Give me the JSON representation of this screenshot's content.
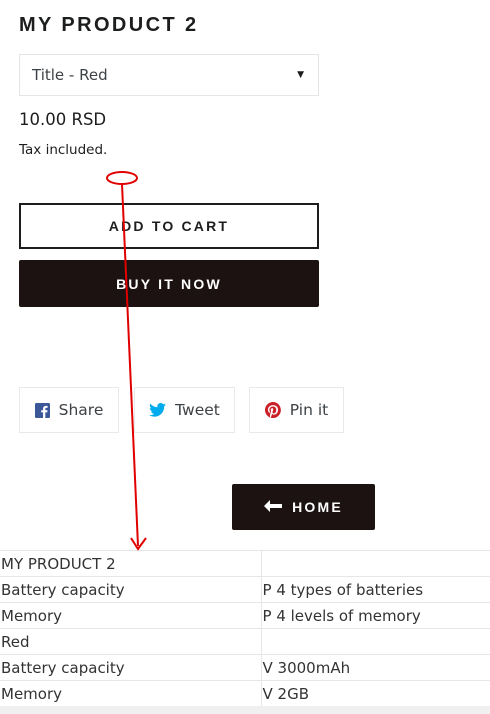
{
  "product": {
    "title": "MY PRODUCT 2",
    "variant_select": {
      "value": "Title  -  Red"
    },
    "price": "10.00 RSD",
    "tax_note": "Tax included."
  },
  "buttons": {
    "add_to_cart": "ADD TO CART",
    "buy_it_now": "BUY IT NOW",
    "home": "HOME"
  },
  "social": {
    "share": {
      "label": "Share",
      "icon": "facebook-icon",
      "color": "#3b5998"
    },
    "tweet": {
      "label": "Tweet",
      "icon": "twitter-icon",
      "color": "#00aced"
    },
    "pin": {
      "label": "Pin it",
      "icon": "pinterest-icon",
      "color": "#cb2027"
    }
  },
  "specs_table": {
    "rows": [
      [
        "MY PRODUCT 2",
        ""
      ],
      [
        "Battery capacity",
        "P 4 types of batteries"
      ],
      [
        "Memory",
        "P 4 levels of memory"
      ],
      [
        "Red",
        ""
      ],
      [
        "Battery capacity",
        "V 3000mAh"
      ],
      [
        "Memory",
        "V 2GB"
      ]
    ]
  },
  "annotation": {
    "type": "red-arrow",
    "color": "#e00000"
  },
  "theme": {
    "dark_button": "#1c1212",
    "text": "#1c1d1d",
    "border": "#e5e5e5"
  }
}
